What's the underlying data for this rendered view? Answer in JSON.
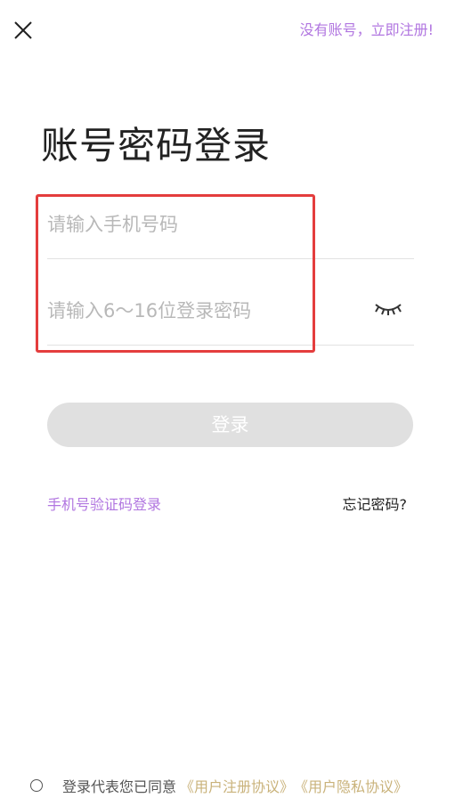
{
  "header": {
    "close_icon": "close-icon",
    "register_link": "没有账号，立即注册!"
  },
  "page": {
    "title": "账号密码登录"
  },
  "form": {
    "phone_placeholder": "请输入手机号码",
    "phone_value": "",
    "password_placeholder": "请输入6～16位登录密码",
    "password_value": "",
    "password_toggle_icon": "eye-closed-icon",
    "login_button": "登录"
  },
  "links": {
    "sms_login": "手机号验证码登录",
    "forgot_password": "忘记密码?"
  },
  "agreement": {
    "prefix": "登录代表您已同意",
    "user_agreement": "《用户注册协议》",
    "privacy_agreement": "《用户隐私协议》"
  },
  "colors": {
    "accent_purple": "#b176e0",
    "agreement_gold": "#c9b27a",
    "highlight_red": "#e43d3d",
    "button_disabled": "#e0e0e0"
  }
}
